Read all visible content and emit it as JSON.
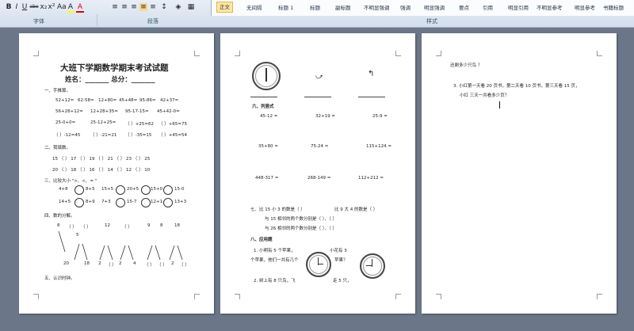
{
  "ribbon": {
    "groups": {
      "font_label": "字体",
      "paragraph_label": "段落",
      "styles_label": "样式"
    },
    "format_buttons": [
      "B",
      "I",
      "U",
      "abe",
      "x₂",
      "x²",
      "Aa",
      "A",
      "A"
    ],
    "styles": [
      "正文",
      "无间隔",
      "标题 1",
      "标题",
      "副标题",
      "不明显强调",
      "强调",
      "明显强调",
      "要点",
      "引用",
      "明显引用",
      "不明显参考",
      "明显参考",
      "书籍标题"
    ]
  },
  "page1": {
    "title": "大班下学期数学期末考试试题",
    "name_line": "姓名：_______  总分：_______",
    "s1": "一、手推算。",
    "r1": [
      "52+12=",
      "62-58=",
      "12+80=",
      "45+48=",
      "95-86=",
      "42+37="
    ],
    "r2": [
      "56+28+12=",
      "12+28+35=",
      "95-17-15=",
      "45+42-0="
    ],
    "r3": [
      "25-0+0=",
      "25-12+25=",
      "（  ）+25=62",
      "（  ）+65=75"
    ],
    "r4": [
      "（  ）-12=45",
      "（  ）-21=21",
      "（  ）-35=15",
      "（  ）+45=54"
    ],
    "s2": "二、我填数。",
    "fill_row1": [
      "15  （   ）  17  （   ）  19  （   ）  21  （   ）  23  （   ）  25"
    ],
    "fill_row2": [
      "20  （   ）  18  （   ）  16  （   ）  14  （   ）  12  （   ）  10"
    ],
    "s3": "三、比较大小 \">、<、= \"",
    "cmp1": [
      "4+8",
      "8+5",
      "15+5",
      "20+5",
      "15+0",
      "15-0"
    ],
    "cmp2": [
      "14+5",
      "8+9",
      "7+3",
      "15-7",
      "12+1",
      "13+3"
    ],
    "s4": "四、数的分解。",
    "decomp_top": [
      "8",
      "（  ）",
      "（  ）",
      "12",
      "（  ）",
      "9",
      "8",
      "18"
    ],
    "decomp_mid": "5",
    "decomp_bottom": [
      "20",
      "18",
      "2",
      "（  ）",
      "2",
      "4",
      "（  ）",
      "（  ）",
      "2",
      "（  ）"
    ],
    "s5": "五、认识时钟。"
  },
  "page2": {
    "s6": "六、列竖式",
    "v1": [
      "45-12 =",
      "32+19 =",
      "25-9  ="
    ],
    "v2": [
      "35+80 =",
      "75-24 =",
      "115+124 ="
    ],
    "v3": [
      "448-317 =",
      "268-149 =",
      "112+212 ="
    ],
    "s7_a": "七、比 15 小 3 的数是（    ）",
    "s7_b": "比 9 大 4 的数是（    ）",
    "s7_c": "与 15 相邻的两个数分别是（    ）、（    ）",
    "s7_d": "与 26 相邻的两个数分别是（    ）、（    ）",
    "s8": "八、应用题",
    "q1a": "1.    小明有 5 个苹果，",
    "q1b": "小花有 3",
    "q1c": "个苹果，他们一共有几个",
    "q1d": "苹果？",
    "q2a": "2.    树上有 8 只鸟，飞",
    "q2b": "走 5 只，"
  },
  "page3": {
    "p1": "还剩多少只鸟 ？",
    "p2": "3.    小红第一天看 20 页书，第二天看 10 页书，第三天看 15 页，",
    "p3": "小红  三天一共看多少页？"
  }
}
